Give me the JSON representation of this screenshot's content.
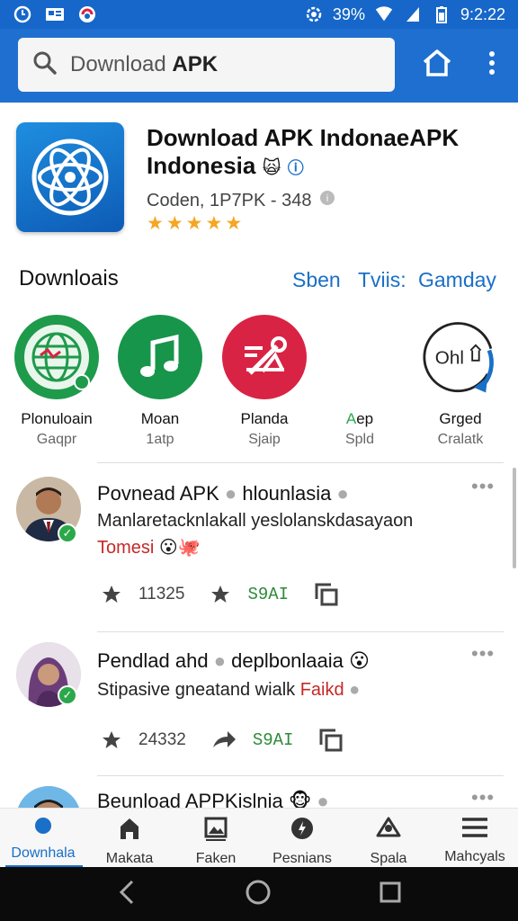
{
  "status_bar": {
    "battery": "39%",
    "time": "9:2:22"
  },
  "search": {
    "placeholder_prefix": "Download ",
    "placeholder_bold": "APK"
  },
  "app": {
    "title": "Download APK IndonaeAPK Indonesia",
    "meta": "Coden, 1P7PK - 348",
    "rating_stars": 5
  },
  "section": {
    "title": "Downloais",
    "tabs": [
      "Sben",
      "Tviis:",
      "Gamday"
    ]
  },
  "categories": [
    {
      "name": "Plonuloain",
      "sub": "Gaqpr",
      "color": "#1e9a4b",
      "icon": "globe-icon"
    },
    {
      "name": "Moan",
      "sub": "1atp",
      "color": "#17954a",
      "icon": "music-note-icon"
    },
    {
      "name": "Planda",
      "sub": "Sjaip",
      "color": "#d92344",
      "icon": "tools-icon"
    },
    {
      "name": "Aep",
      "sub": "Spld",
      "color": "#ffffff",
      "icon": "none"
    },
    {
      "name": "Grged",
      "sub": "Cralatk",
      "color": "#1a6fc7",
      "icon": "ohl-logo-icon"
    }
  ],
  "posts": [
    {
      "title": "Povnead APK",
      "title2": "hlounlasia",
      "body": "Manlaretacknlakall yeslolanskdasayaon",
      "tag": "Tomesi",
      "like_count": "11325",
      "share_label": "S9AI"
    },
    {
      "title": "Pendlad ahd",
      "title2": "deplbonlaaia",
      "body": "Stipasive gneatand wialk",
      "tag": "Faikd",
      "like_count": "24332",
      "share_label": "S9AI"
    },
    {
      "title": "Beunload APPKislnia"
    }
  ],
  "bottom_nav": [
    {
      "label": "Downhala",
      "icon": "download-globe-icon"
    },
    {
      "label": "Makata",
      "icon": "house-icon"
    },
    {
      "label": "Faken",
      "icon": "image-icon"
    },
    {
      "label": "Pesnians",
      "icon": "compass-icon"
    },
    {
      "label": "Spala",
      "icon": "person-icon"
    },
    {
      "label": "Mahcyals",
      "icon": "menu-icon"
    }
  ],
  "colors": {
    "primary": "#1f6fd0",
    "accent_blue": "#1a6fc7",
    "star": "#f5a623",
    "green": "#2ba84a",
    "red": "#c62828"
  }
}
